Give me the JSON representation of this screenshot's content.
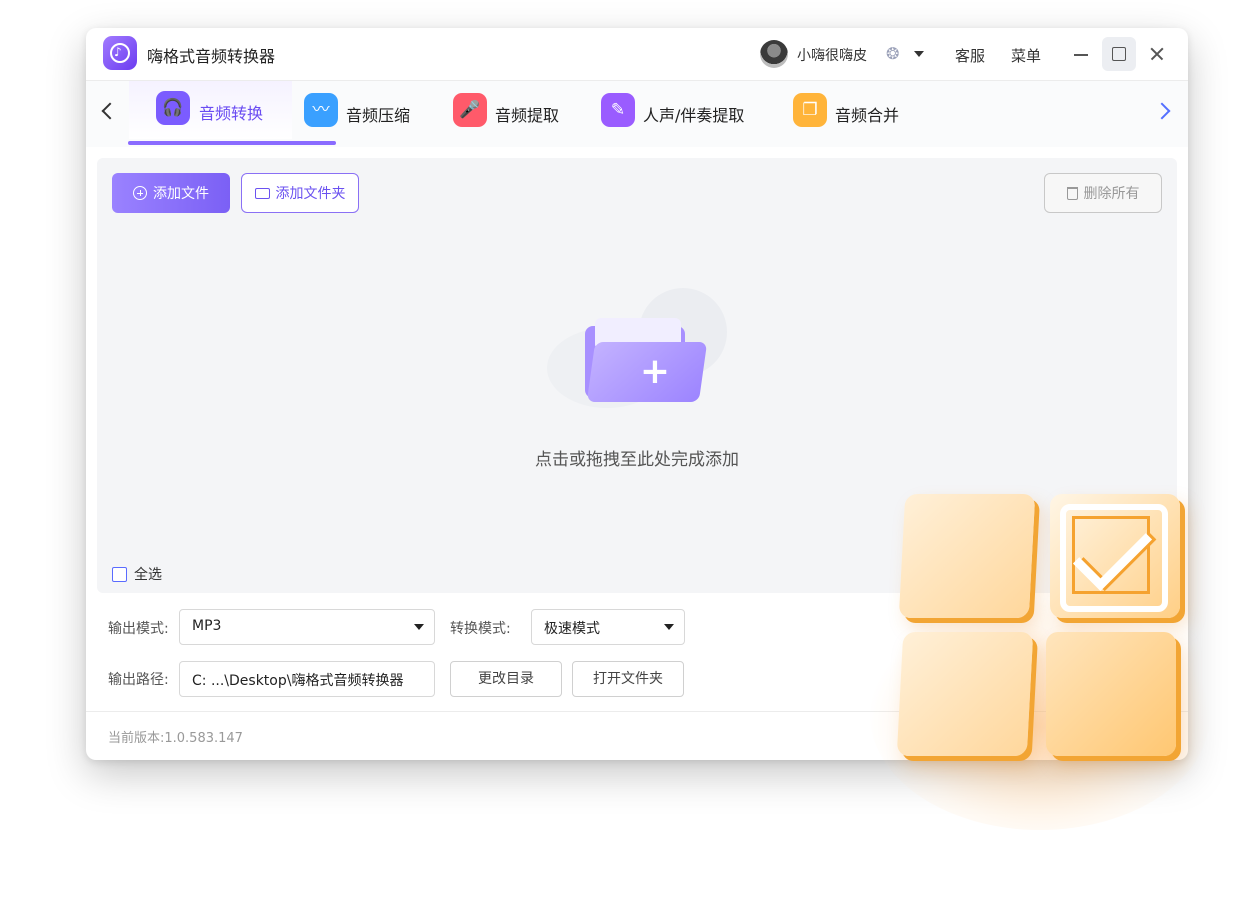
{
  "app": {
    "title": "嗨格式音频转换器"
  },
  "user": {
    "name": "小嗨很嗨皮"
  },
  "titlebar": {
    "service": "客服",
    "menu": "菜单"
  },
  "tabs": [
    {
      "label": "音频转换",
      "color": "#7b5cff",
      "icon": "headphones-icon"
    },
    {
      "label": "音频压缩",
      "color": "#3aa0ff",
      "icon": "waveform-icon"
    },
    {
      "label": "音频提取",
      "color": "#ff5a6a",
      "icon": "microphone-icon"
    },
    {
      "label": "人声/伴奏提取",
      "color": "#9a5cff",
      "icon": "vocal-icon"
    },
    {
      "label": "音频合并",
      "color": "#ffb43a",
      "icon": "merge-icon"
    }
  ],
  "toolbar": {
    "add_file": "添加文件",
    "add_folder": "添加文件夹",
    "delete_all": "删除所有"
  },
  "dropzone": {
    "hint": "点击或拖拽至此处完成添加"
  },
  "list": {
    "select_all": "全选"
  },
  "output": {
    "mode_label": "输出模式:",
    "mode_value": "MP3",
    "convert_label": "转换模式:",
    "convert_value": "极速模式",
    "path_label": "输出路径:",
    "path_value": "C: ...\\Desktop\\嗨格式音频转换器",
    "change_dir": "更改目录",
    "open_folder": "打开文件夹"
  },
  "footer": {
    "version": "当前版本:1.0.583.147"
  }
}
